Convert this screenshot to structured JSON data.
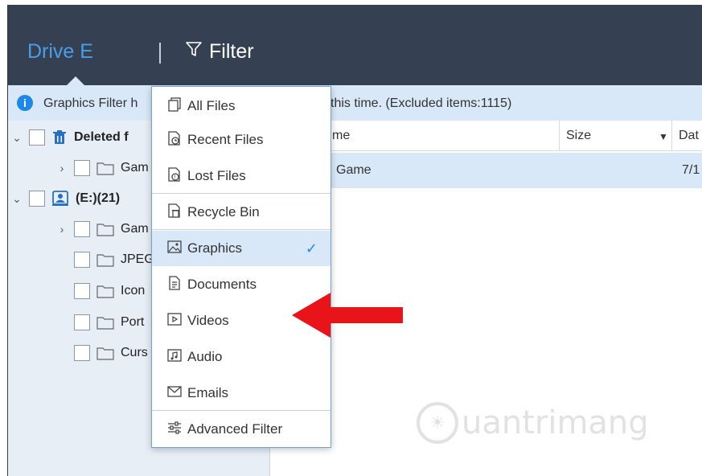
{
  "header": {
    "drive_label": "Drive E",
    "filter_label": "Filter"
  },
  "infobar": {
    "message_left": "Graphics Filter h",
    "message_right": "this time. (Excluded items:1115)"
  },
  "tree": {
    "items": [
      {
        "label": "Deleted f",
        "icon": "trash-icon"
      },
      {
        "label": "Gam",
        "icon": "folder-icon"
      },
      {
        "label": "(E:)(21)",
        "icon": "user-drive-icon"
      },
      {
        "label": "Gam",
        "icon": "folder-icon"
      },
      {
        "label": "JPEG",
        "icon": "folder-icon"
      },
      {
        "label": "Icon",
        "icon": "folder-icon"
      },
      {
        "label": "Port",
        "icon": "folder-icon"
      },
      {
        "label": "Curs",
        "icon": "folder-icon"
      }
    ]
  },
  "list": {
    "columns": [
      "me",
      "Size",
      "Dat"
    ],
    "rows": [
      {
        "name": "Game",
        "date": "7/1"
      }
    ]
  },
  "dropdown": {
    "items": [
      {
        "label": "All Files",
        "icon": "all-files-icon"
      },
      {
        "label": "Recent Files",
        "icon": "recent-files-icon"
      },
      {
        "label": "Lost Files",
        "icon": "lost-files-icon"
      },
      {
        "label": "Recycle Bin",
        "icon": "recycle-bin-icon"
      },
      {
        "label": "Graphics",
        "icon": "graphics-icon",
        "selected": true
      },
      {
        "label": "Documents",
        "icon": "documents-icon"
      },
      {
        "label": "Videos",
        "icon": "videos-icon"
      },
      {
        "label": "Audio",
        "icon": "audio-icon"
      },
      {
        "label": "Emails",
        "icon": "emails-icon"
      },
      {
        "label": "Advanced Filter",
        "icon": "advanced-filter-icon"
      }
    ],
    "check_mark": "✓"
  },
  "watermark": {
    "text": "uantrimang"
  },
  "colors": {
    "header_bg": "#354052",
    "accent": "#1e88e5",
    "selection_bg": "#d9e8f8",
    "arrow": "#e8141a"
  }
}
